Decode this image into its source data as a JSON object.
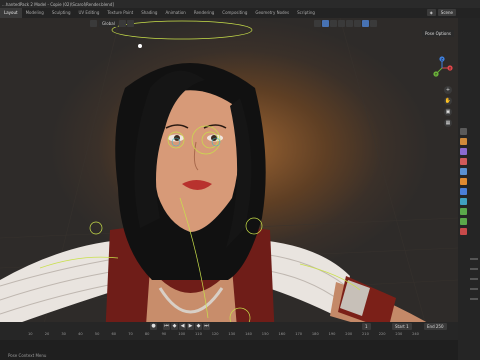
{
  "window": {
    "title": "...hantedPack 2 Model - Copie (02)\\Scarol\\Render.blend]"
  },
  "workspaces": [
    {
      "label": "Layout",
      "active": true
    },
    {
      "label": "Modeling"
    },
    {
      "label": "Sculpting"
    },
    {
      "label": "UV Editing"
    },
    {
      "label": "Texture Paint"
    },
    {
      "label": "Shading"
    },
    {
      "label": "Animation"
    },
    {
      "label": "Rendering"
    },
    {
      "label": "Compositing"
    },
    {
      "label": "Geometry Nodes"
    },
    {
      "label": "Scripting"
    }
  ],
  "scene": {
    "label": "Scene"
  },
  "viewport": {
    "mode": "Global",
    "pose_options": "Pose Options"
  },
  "gizmo": {
    "x": "X",
    "y": "Y",
    "z": "Z"
  },
  "timeline": {
    "frame": "1",
    "start_label": "Start",
    "start": "1",
    "end_label": "End",
    "end": "250",
    "ticks": [
      "10",
      "20",
      "30",
      "40",
      "50",
      "60",
      "70",
      "80",
      "90",
      "100",
      "110",
      "120",
      "130",
      "140",
      "150",
      "160",
      "170",
      "180",
      "190",
      "200",
      "210",
      "220",
      "230",
      "240"
    ]
  },
  "status": {
    "text": "Pose Context Menu"
  },
  "colors": {
    "accent": "#4772b3",
    "armature": "#c9e04a",
    "axis_x": "#e0464a",
    "axis_y": "#6ab03a",
    "axis_z": "#3f7fdc"
  }
}
